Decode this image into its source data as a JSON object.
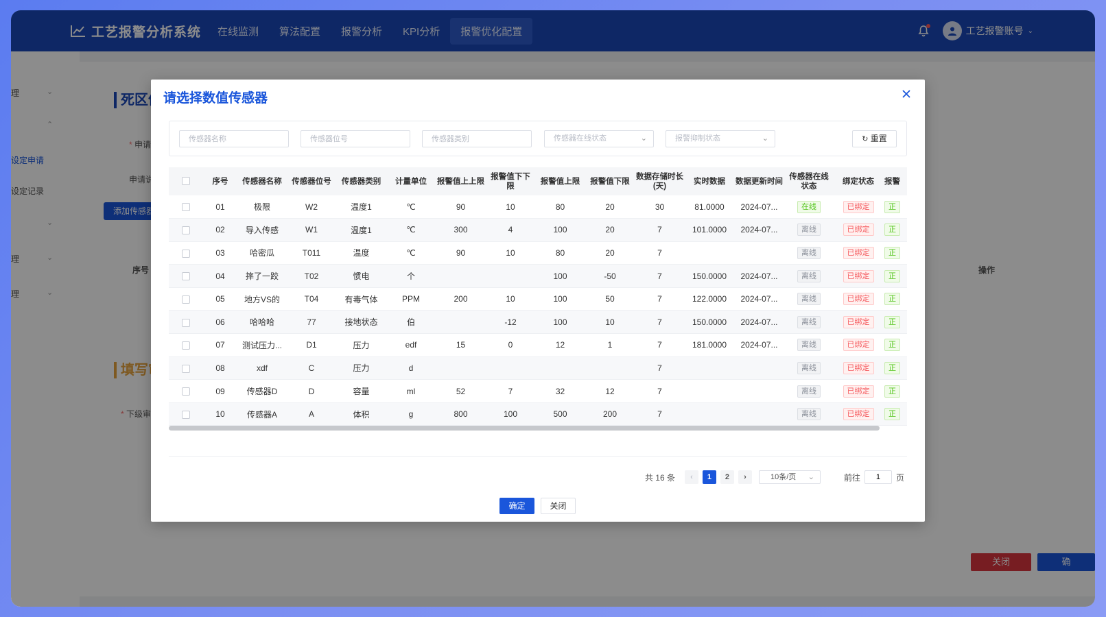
{
  "app": {
    "title": "工艺报警分析系统",
    "nav": [
      "在线监测",
      "算法配置",
      "报警分析",
      "KPI分析",
      "报警优化配置"
    ],
    "active_nav": "报警优化配置",
    "user": "工艺报警账号"
  },
  "background_page": {
    "sidebar": [
      "理",
      "设定申请",
      "设定记录",
      "理",
      "理"
    ],
    "section_title_1": "死区值",
    "section_title_2": "填写审",
    "field_apply": "申请",
    "field_apply_reason": "申请说",
    "add_sensor_btn": "添加传感器",
    "table_col_index": "序号",
    "table_col_action": "操作",
    "field_reviewer": "下级审",
    "close_btn": "关闭",
    "submit_btn": "确"
  },
  "modal": {
    "title": "请选择数值传感器",
    "filters": {
      "name_placeholder": "传感器名称",
      "tag_placeholder": "传感器位号",
      "type_placeholder": "传感器类别",
      "online_placeholder": "传感器在线状态",
      "suppress_placeholder": "报警抑制状态",
      "reset_label": "重置"
    },
    "columns": [
      "序号",
      "传感器名称",
      "传感器位号",
      "传感器类别",
      "计量单位",
      "报警值上上限",
      "报警值下下限",
      "报警值上限",
      "报警值下限",
      "数据存储时长(天)",
      "实时数据",
      "数据更新时间",
      "传感器在线状态",
      "绑定状态",
      "报警"
    ],
    "rows": [
      {
        "idx": "01",
        "name": "极限",
        "tag": "W2",
        "type": "温度1",
        "unit": "℃",
        "hh": "90",
        "ll": "10",
        "h": "80",
        "l": "20",
        "days": "30",
        "rt": "81.0000",
        "time": "2024-07...",
        "online": "在线",
        "bind": "已绑定",
        "alarm": "正"
      },
      {
        "idx": "02",
        "name": "导入传感",
        "tag": "W1",
        "type": "温度1",
        "unit": "℃",
        "hh": "300",
        "ll": "4",
        "h": "100",
        "l": "20",
        "days": "7",
        "rt": "101.0000",
        "time": "2024-07...",
        "online": "离线",
        "bind": "已绑定",
        "alarm": "正"
      },
      {
        "idx": "03",
        "name": "哈密瓜",
        "tag": "T011",
        "type": "温度",
        "unit": "℃",
        "hh": "90",
        "ll": "10",
        "h": "80",
        "l": "20",
        "days": "7",
        "rt": "",
        "time": "",
        "online": "离线",
        "bind": "已绑定",
        "alarm": "正"
      },
      {
        "idx": "04",
        "name": "摔了一跤",
        "tag": "T02",
        "type": "惯电",
        "unit": "个",
        "hh": "",
        "ll": "",
        "h": "100",
        "l": "-50",
        "days": "7",
        "rt": "150.0000",
        "time": "2024-07...",
        "online": "离线",
        "bind": "已绑定",
        "alarm": "正"
      },
      {
        "idx": "05",
        "name": "地方VS的",
        "tag": "T04",
        "type": "有毒气体",
        "unit": "PPM",
        "hh": "200",
        "ll": "10",
        "h": "100",
        "l": "50",
        "days": "7",
        "rt": "122.0000",
        "time": "2024-07...",
        "online": "离线",
        "bind": "已绑定",
        "alarm": "正"
      },
      {
        "idx": "06",
        "name": "哈哈哈",
        "tag": "77",
        "type": "接地状态",
        "unit": "伯",
        "hh": "",
        "ll": "-12",
        "h": "100",
        "l": "10",
        "days": "7",
        "rt": "150.0000",
        "time": "2024-07...",
        "online": "离线",
        "bind": "已绑定",
        "alarm": "正"
      },
      {
        "idx": "07",
        "name": "测试压力...",
        "tag": "D1",
        "type": "压力",
        "unit": "edf",
        "hh": "15",
        "ll": "0",
        "h": "12",
        "l": "1",
        "days": "7",
        "rt": "181.0000",
        "time": "2024-07...",
        "online": "离线",
        "bind": "已绑定",
        "alarm": "正"
      },
      {
        "idx": "08",
        "name": "xdf",
        "tag": "C",
        "type": "压力",
        "unit": "d",
        "hh": "",
        "ll": "",
        "h": "",
        "l": "",
        "days": "7",
        "rt": "",
        "time": "",
        "online": "离线",
        "bind": "已绑定",
        "alarm": "正"
      },
      {
        "idx": "09",
        "name": "传感器D",
        "tag": "D",
        "type": "容量",
        "unit": "ml",
        "hh": "52",
        "ll": "7",
        "h": "32",
        "l": "12",
        "days": "7",
        "rt": "",
        "time": "",
        "online": "离线",
        "bind": "已绑定",
        "alarm": "正"
      },
      {
        "idx": "10",
        "name": "传感器A",
        "tag": "A",
        "type": "体积",
        "unit": "g",
        "hh": "800",
        "ll": "100",
        "h": "500",
        "l": "200",
        "days": "7",
        "rt": "",
        "time": "",
        "online": "离线",
        "bind": "已绑定",
        "alarm": "正"
      }
    ],
    "pagination": {
      "total": "共 16 条",
      "pages": [
        "1",
        "2"
      ],
      "current": "1",
      "page_size": "10条/页",
      "goto_label": "前往",
      "goto_value": "1",
      "page_suffix": "页"
    },
    "confirm_label": "确定",
    "close_label": "关闭"
  }
}
